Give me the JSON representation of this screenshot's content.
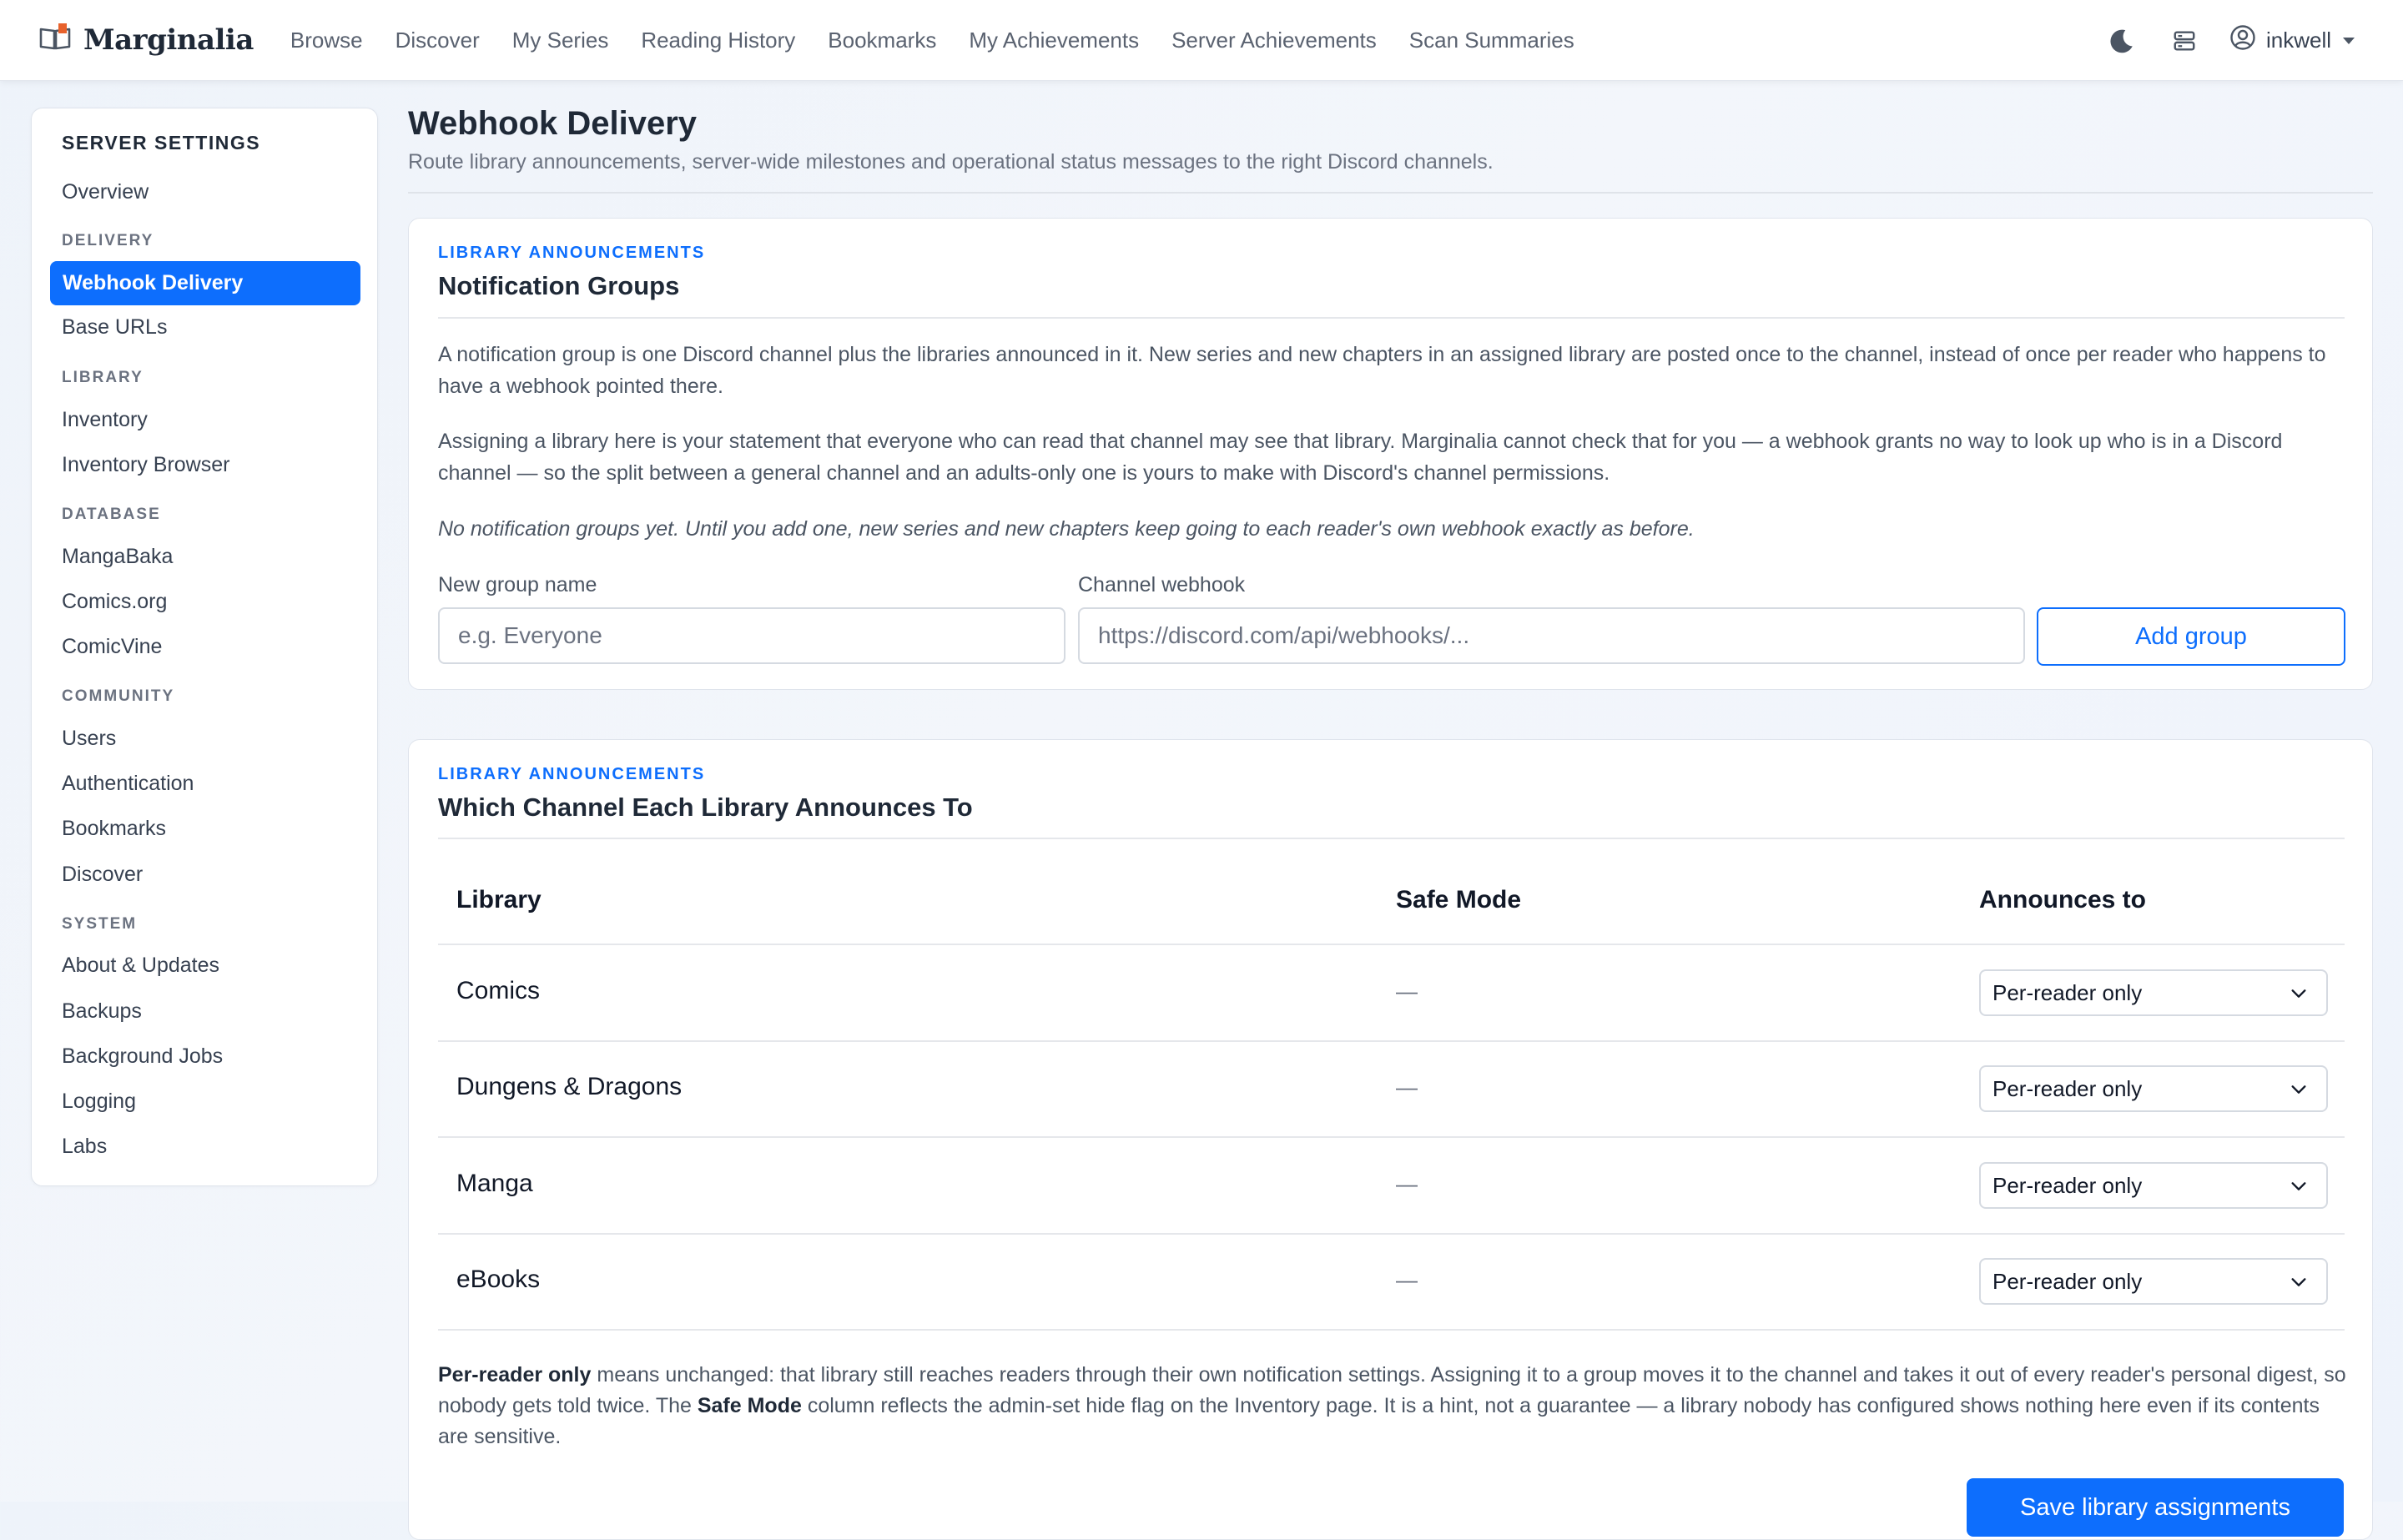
{
  "nav": {
    "brand": "Marginalia",
    "links": [
      "Browse",
      "Discover",
      "My Series",
      "Reading History",
      "Bookmarks",
      "My Achievements",
      "Server Achievements",
      "Scan Summaries"
    ],
    "user": "inkwell"
  },
  "sidebar": {
    "title": "SERVER SETTINGS",
    "overview": "Overview",
    "delivery": {
      "heading": "DELIVERY",
      "items": [
        "Webhook Delivery",
        "Base URLs"
      ]
    },
    "library": {
      "heading": "LIBRARY",
      "items": [
        "Inventory",
        "Inventory Browser"
      ]
    },
    "database": {
      "heading": "DATABASE",
      "items": [
        "MangaBaka",
        "Comics.org",
        "ComicVine"
      ]
    },
    "community": {
      "heading": "COMMUNITY",
      "items": [
        "Users",
        "Authentication",
        "Bookmarks",
        "Discover"
      ]
    },
    "system": {
      "heading": "SYSTEM",
      "items": [
        "About & Updates",
        "Backups",
        "Background Jobs",
        "Logging",
        "Labs"
      ]
    }
  },
  "header": {
    "title": "Webhook Delivery",
    "subtitle": "Route library announcements, server-wide milestones and operational status messages to the right Discord channels."
  },
  "groups_card": {
    "eyebrow": "LIBRARY ANNOUNCEMENTS",
    "title": "Notification Groups",
    "para1": "A notification group is one Discord channel plus the libraries announced in it. New series and new chapters in an assigned library are posted once to the channel, instead of once per reader who happens to have a webhook pointed there.",
    "para2": "Assigning a library here is your statement that everyone who can read that channel may see that library. Marginalia cannot check that for you — a webhook grants no way to look up who is in a Discord channel — so the split between a general channel and an adults-only one is yours to make with Discord's channel permissions.",
    "empty_note": "No notification groups yet. Until you add one, new series and new chapters keep going to each reader's own webhook exactly as before.",
    "name_label": "New group name",
    "name_placeholder": "e.g. Everyone",
    "webhook_label": "Channel webhook",
    "webhook_placeholder": "https://discord.com/api/webhooks/...",
    "add_button": "Add group"
  },
  "channels_card": {
    "eyebrow": "LIBRARY ANNOUNCEMENTS",
    "title": "Which Channel Each Library Announces To",
    "columns": [
      "Library",
      "Safe Mode",
      "Announces to"
    ],
    "rows": [
      {
        "library": "Comics",
        "safe_mode": "—",
        "announces_to": "Per-reader only"
      },
      {
        "library": "Dungens & Dragons",
        "safe_mode": "—",
        "announces_to": "Per-reader only"
      },
      {
        "library": "Manga",
        "safe_mode": "—",
        "announces_to": "Per-reader only"
      },
      {
        "library": "eBooks",
        "safe_mode": "—",
        "announces_to": "Per-reader only"
      }
    ],
    "footnote": {
      "bold1": "Per-reader only",
      "text1": " means unchanged: that library still reaches readers through their own notification settings. Assigning it to a group moves it to the channel and takes it out of every reader's personal digest, so nobody gets told twice. The ",
      "bold2": "Safe Mode",
      "text2": " column reflects the admin-set hide flag on the Inventory page. It is a hint, not a guarantee — a library nobody has configured shows nothing here even if its contents are sensitive."
    },
    "save_button": "Save library assignments"
  },
  "colors": {
    "accent": "#0d6efd",
    "brand_icon": "#e8622c"
  },
  "icons": [
    "book-logo-icon",
    "moon-icon",
    "server-icon",
    "user-circle-icon",
    "chevron-down-icon"
  ]
}
